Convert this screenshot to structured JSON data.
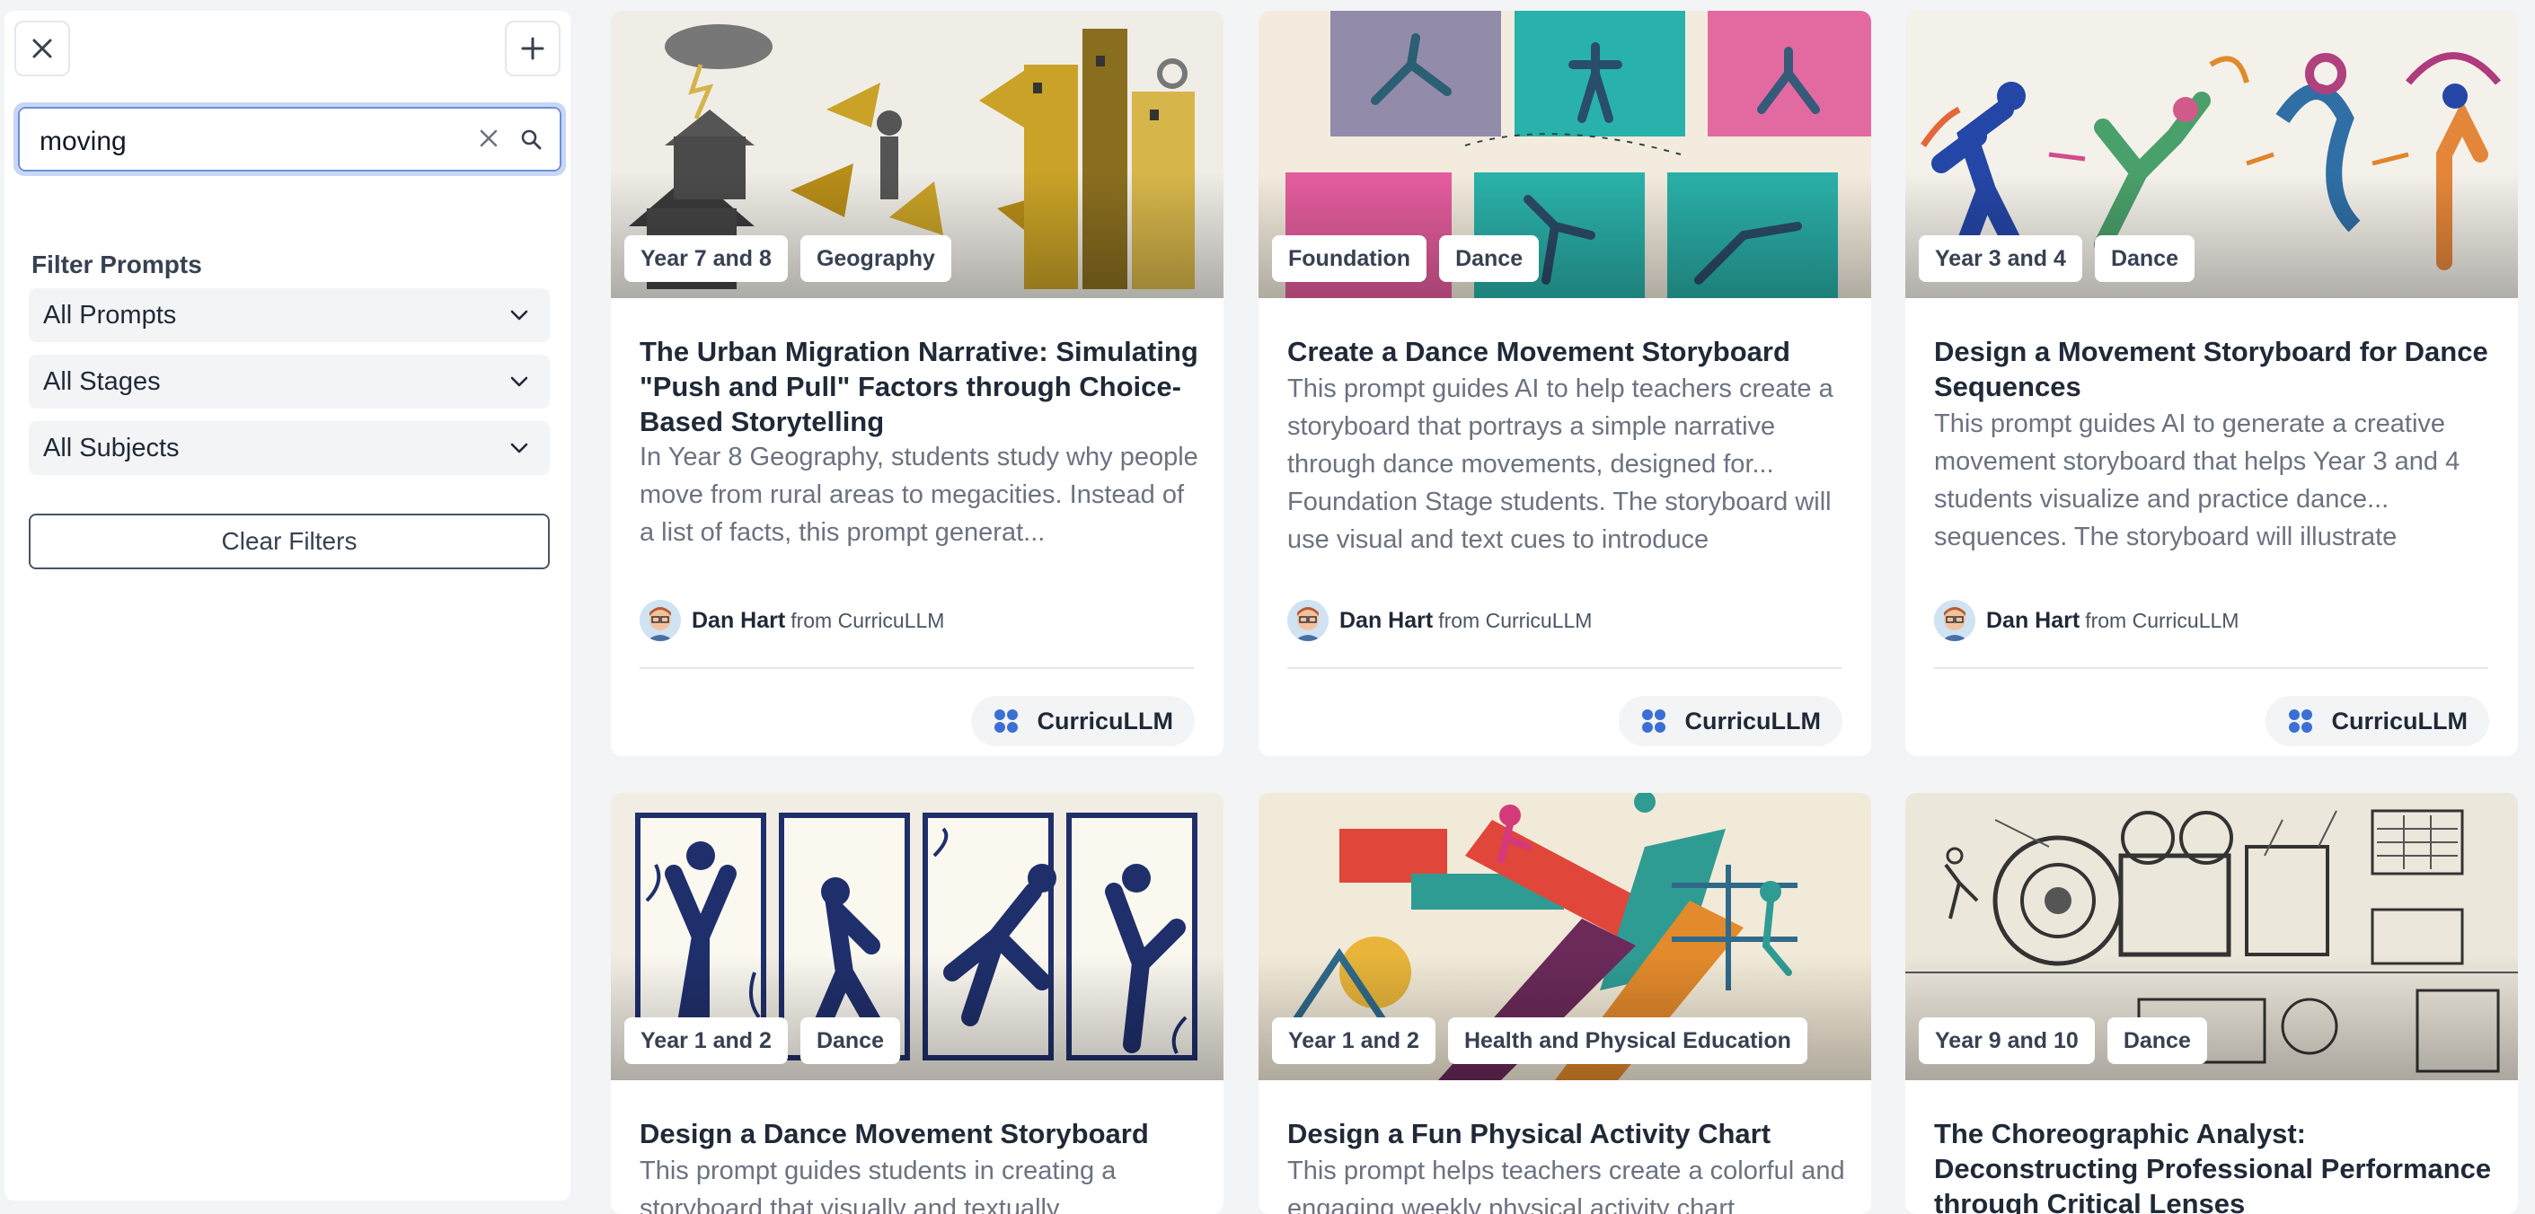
{
  "sidebar": {
    "search": {
      "value": "moving"
    },
    "filter_title": "Filter Prompts",
    "selects": [
      {
        "label": "All Prompts"
      },
      {
        "label": "All Stages"
      },
      {
        "label": "All Subjects"
      }
    ],
    "clear_filters_label": "Clear Filters"
  },
  "cards": [
    {
      "tags": [
        "Year 7 and 8",
        "Geography"
      ],
      "title": "The Urban Migration Narrative: Simulating \"Push and Pull\" Factors through Choice-Based Storytelling",
      "description": "In Year 8 Geography, students study why people move from rural areas to megacities. Instead of a list of facts, this prompt generat...",
      "author": "Dan Hart",
      "from": "from CurricuLLM",
      "brand": "CurricuLLM"
    },
    {
      "tags": [
        "Foundation",
        "Dance"
      ],
      "title": "Create a Dance Movement Storyboard",
      "description": "This prompt guides AI to help teachers create a storyboard that portrays a simple narrative through dance movements, designed for... Foundation Stage students. The storyboard will use visual and text cues to introduce",
      "author": "Dan Hart",
      "from": "from CurricuLLM",
      "brand": "CurricuLLM"
    },
    {
      "tags": [
        "Year 3 and 4",
        "Dance"
      ],
      "title": "Design a Movement Storyboard for Dance Sequences",
      "description": "This prompt guides AI to generate a creative movement storyboard that helps Year 3 and 4 students visualize and practice dance... sequences. The storyboard will illustrate",
      "author": "Dan Hart",
      "from": "from CurricuLLM",
      "brand": "CurricuLLM"
    },
    {
      "tags": [
        "Year 1 and 2",
        "Dance"
      ],
      "title": "Design a Dance Movement Storyboard",
      "description": "This prompt guides students in creating a storyboard that visually and textually",
      "author": "",
      "from": "",
      "brand": ""
    },
    {
      "tags": [
        "Year 1 and 2",
        "Health and Physical Education"
      ],
      "title": "Design a Fun Physical Activity Chart",
      "description": "This prompt helps teachers create a colorful and engaging weekly physical activity chart",
      "author": "",
      "from": "",
      "brand": ""
    },
    {
      "tags": [
        "Year 9 and 10",
        "Dance"
      ],
      "title": "The Choreographic Analyst: Deconstructing Professional Performance through Critical Lenses",
      "description": "",
      "author": "",
      "from": "",
      "brand": ""
    }
  ],
  "icons": {
    "close": "close-icon",
    "add": "plus-icon",
    "clear_search": "clear-icon",
    "search": "search-icon",
    "chevron": "chevron-down-icon",
    "brand": "curricullm-logo-icon"
  },
  "colors": {
    "accent": "#6b8fd6",
    "brand_blue": "#3b6fd4",
    "page_bg": "#f3f4f6"
  }
}
